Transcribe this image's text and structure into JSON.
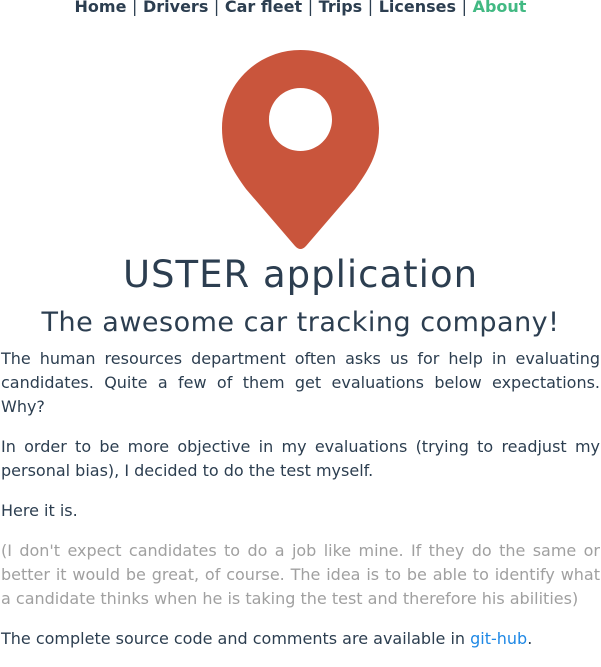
{
  "nav": {
    "items": [
      {
        "label": "Home"
      },
      {
        "label": "Drivers"
      },
      {
        "label": "Car fleet"
      },
      {
        "label": "Trips"
      },
      {
        "label": "Licenses"
      },
      {
        "label": "About"
      }
    ],
    "separator": "|",
    "active_color": "#42b983"
  },
  "logo": {
    "icon": "map-pin-icon",
    "color": "#c9553c"
  },
  "header": {
    "title": "USTER application",
    "subtitle": "The awesome car tracking company!"
  },
  "content": {
    "p1": "The human resources department often asks us for help in evaluating candidates. Quite a few of them get evaluations below expectations. Why?",
    "p2": "In order to be more objective in my evaluations (trying to readjust my personal bias), I decided to do the test myself.",
    "p3": "Here it is.",
    "p4": "(I don't expect candidates to do a job like mine. If they do the same or better it would be great, of course. The idea is to be able to identify what a candidate thinks when he is taking the test and therefore his abilities)",
    "p5_prefix": "The complete source code and comments are available in ",
    "p5_link": "git-hub",
    "p5_suffix": "."
  }
}
